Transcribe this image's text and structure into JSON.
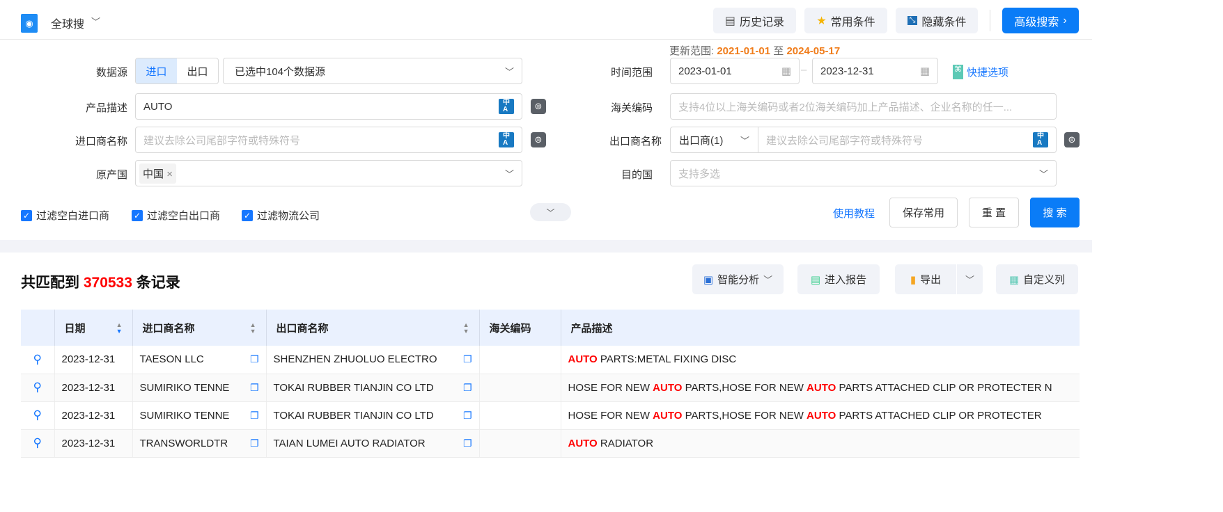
{
  "header": {
    "scope": "全球搜",
    "buttons": [
      "历史记录",
      "常用条件",
      "隐藏条件"
    ],
    "advanced": "高级搜索"
  },
  "filters": {
    "update_label": "更新范围:",
    "update_from": "2021-01-01",
    "update_to_word": "至",
    "update_to": "2024-05-17",
    "datasource_label": "数据源",
    "ds_tabs": [
      "进口",
      "出口"
    ],
    "ds_active": "进口",
    "ds_value": "已选中104个数据源",
    "time_label": "时间范围",
    "date_from": "2023-01-01",
    "date_to": "2023-12-31",
    "date_sep": "–",
    "quick": "快捷选项",
    "product_label": "产品描述",
    "product_value": "AUTO",
    "hs_label": "海关编码",
    "hs_placeholder": "支持4位以上海关编码或者2位海关编码加上产品描述、企业名称的任一...",
    "importer_label": "进口商名称",
    "importer_placeholder": "建议去除公司尾部字符或特殊符号",
    "exporter_label": "出口商名称",
    "exporter_select": "出口商(1)",
    "exporter_placeholder": "建议去除公司尾部字符或特殊符号",
    "origin_label": "原产国",
    "origin_tag": "中国",
    "dest_label": "目的国",
    "dest_placeholder": "支持多选",
    "checkboxes": [
      "过滤空白进口商",
      "过滤空白出口商",
      "过滤物流公司"
    ],
    "tutorial": "使用教程",
    "save": "保存常用",
    "reset": "重 置",
    "search": "搜 索"
  },
  "results": {
    "prefix": "共匹配到",
    "count": "370533",
    "suffix": "条记录",
    "buttons": {
      "analysis": "智能分析",
      "report": "进入报告",
      "export": "导出",
      "columns": "自定义列"
    },
    "columns": [
      "日期",
      "进口商名称",
      "出口商名称",
      "海关编码",
      "产品描述"
    ],
    "rows": [
      {
        "date": "2023-12-31",
        "importer": "TAESON LLC",
        "exporter": "SHENZHEN ZHUOLUO ELECTRO",
        "hs": "",
        "desc": [
          [
            "AUTO",
            true
          ],
          [
            " PARTS:METAL FIXING DISC",
            false
          ]
        ]
      },
      {
        "date": "2023-12-31",
        "importer": "SUMIRIKO TENNE",
        "exporter": "TOKAI RUBBER TIANJIN CO LTD",
        "hs": "",
        "desc": [
          [
            "HOSE FOR NEW ",
            false
          ],
          [
            "AUTO",
            true
          ],
          [
            " PARTS,HOSE FOR NEW ",
            false
          ],
          [
            "AUTO",
            true
          ],
          [
            " PARTS ATTACHED CLIP OR PROTECTER N",
            false
          ]
        ]
      },
      {
        "date": "2023-12-31",
        "importer": "SUMIRIKO TENNE",
        "exporter": "TOKAI RUBBER TIANJIN CO LTD",
        "hs": "",
        "desc": [
          [
            "HOSE FOR NEW ",
            false
          ],
          [
            "AUTO",
            true
          ],
          [
            " PARTS,HOSE FOR NEW ",
            false
          ],
          [
            "AUTO",
            true
          ],
          [
            " PARTS ATTACHED CLIP OR PROTECTER",
            false
          ]
        ]
      },
      {
        "date": "2023-12-31",
        "importer": "TRANSWORLDTR",
        "exporter": "TAIAN LUMEI AUTO RADIATOR",
        "hs": "",
        "desc": [
          [
            "AUTO",
            true
          ],
          [
            " RADIATOR",
            false
          ]
        ]
      }
    ]
  },
  "colors": {
    "accent": "#0a7cf7",
    "highlight": "#ff0000",
    "orange": "#f07c1a"
  }
}
